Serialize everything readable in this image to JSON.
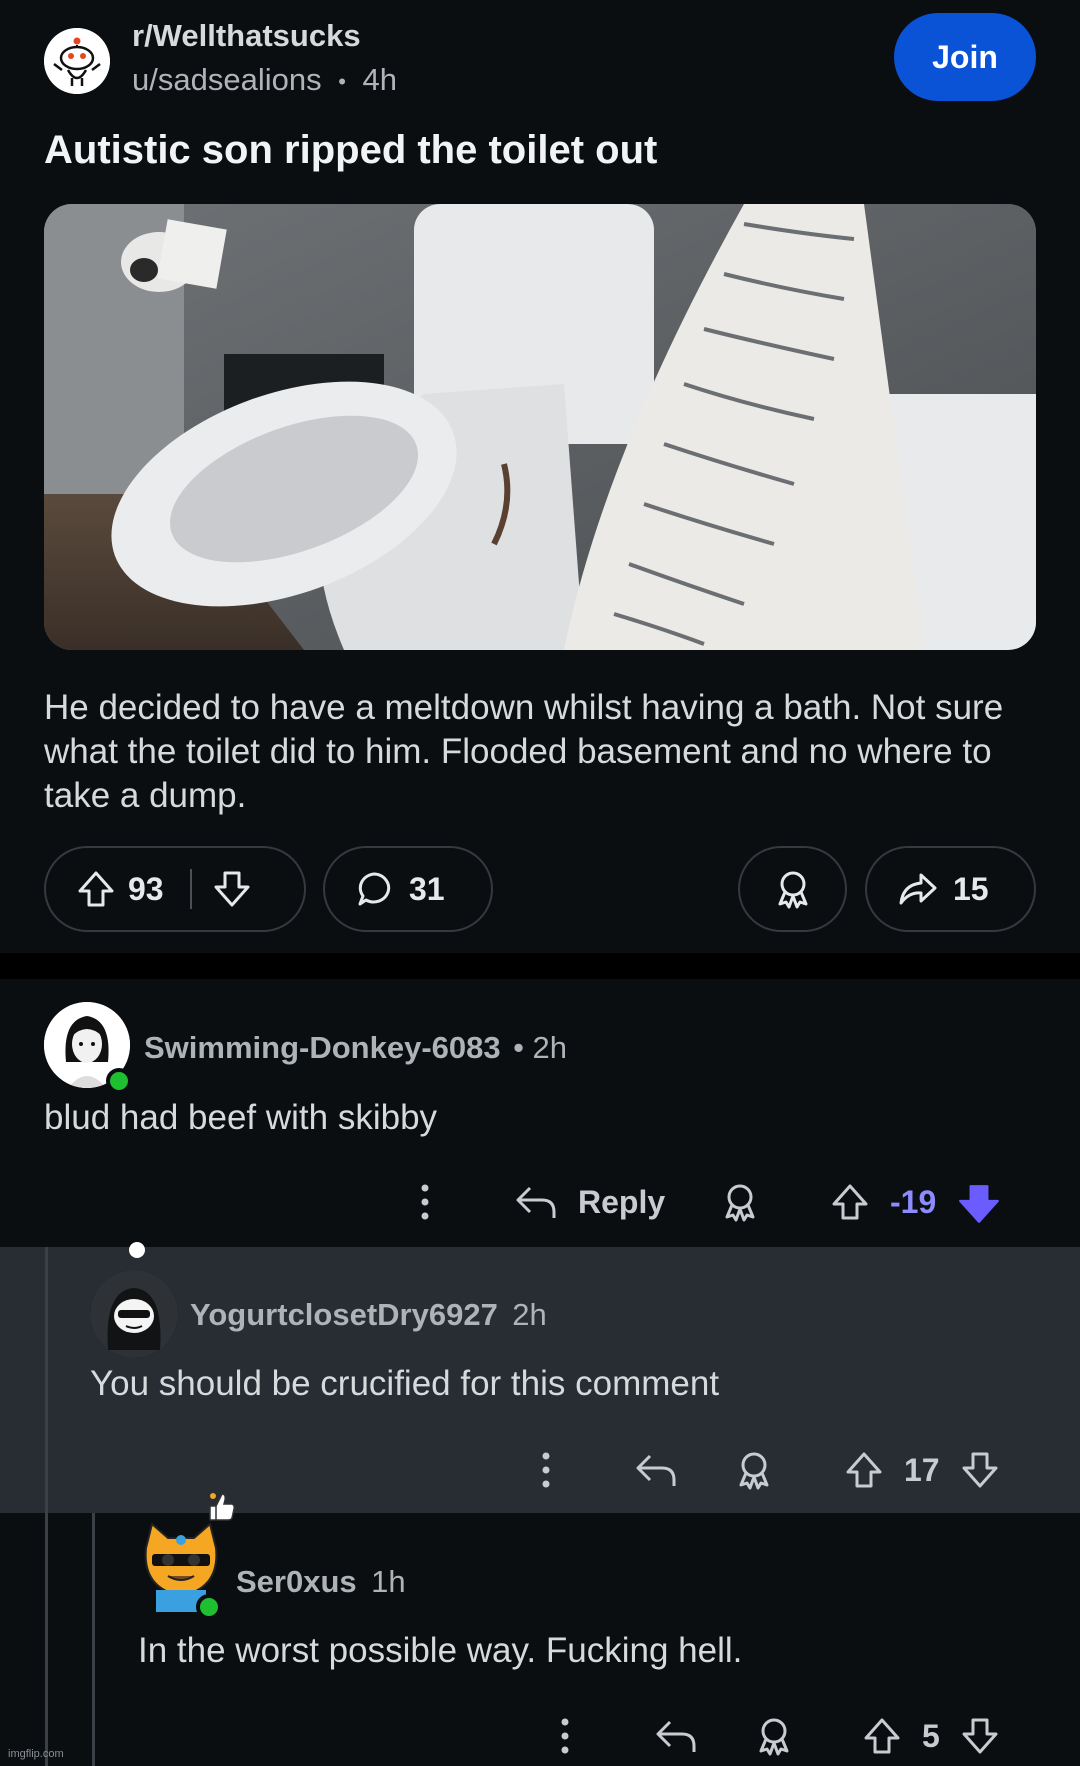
{
  "post": {
    "subreddit": "r/Wellthatsucks",
    "author": "u/sadsealions",
    "separator": "•",
    "time": "4h",
    "join_label": "Join",
    "title": "Autistic son ripped the toilet out",
    "body": "He decided to have a meltdown whilst having a bath. Not sure what the toilet did to him. Flooded basement and no where to take a dump.",
    "upvotes": "93",
    "comments": "31",
    "shares": "15"
  },
  "comments": [
    {
      "user": "Swimming-Donkey-6083",
      "time": "• 2h",
      "text": "blud had beef with skibby",
      "reply_label": "Reply",
      "score": "-19",
      "score_color": "#8c8cff"
    },
    {
      "user": "YogurtclosetDry6927",
      "time": "2h",
      "text": "You should be crucified for this comment",
      "score": "17"
    },
    {
      "user": "Ser0xus",
      "time": "1h",
      "text": "In the worst possible way. Fucking hell.",
      "score": "5"
    }
  ],
  "watermark": "imgflip.com",
  "colors": {
    "join": "#0a52d6",
    "online": "#1fbf32",
    "downvote_active": "#6a5cff"
  }
}
